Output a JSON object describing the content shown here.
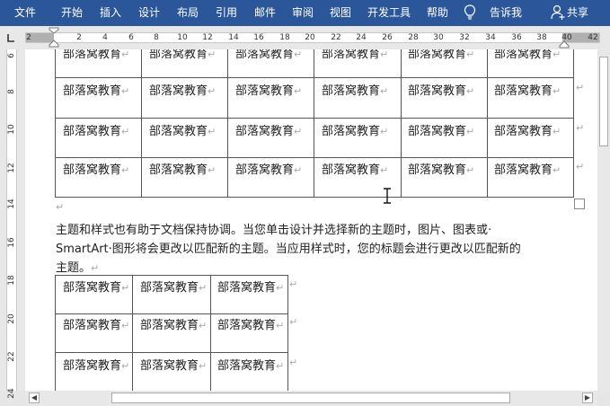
{
  "ribbon": {
    "tabs": [
      "文件",
      "开始",
      "插入",
      "设计",
      "布局",
      "引用",
      "邮件",
      "审阅",
      "视图",
      "开发工具",
      "帮助"
    ],
    "tell_me": "告诉我",
    "share": "共享",
    "background_color": "#2b579a"
  },
  "ruler": {
    "h_labels": [
      "2",
      "2",
      "4",
      "6",
      "8",
      "10",
      "12",
      "14",
      "16",
      "18",
      "20",
      "22",
      "24",
      "26",
      "28",
      "30",
      "32",
      "34",
      "36",
      "38",
      "40",
      "42"
    ],
    "v_labels": [
      "6",
      "8",
      "10",
      "12",
      "14",
      "16",
      "18",
      "20",
      "22",
      "24"
    ]
  },
  "document": {
    "cell_text": "部落窝教育",
    "table1_rows": [
      [
        "部落窝教育",
        "部落窝教育",
        "部落窝教育",
        "部落窝教育",
        "部落窝教育",
        "部落窝教育"
      ],
      [
        "部落窝教育",
        "部落窝教育",
        "部落窝教育",
        "部落窝教育",
        "部落窝教育",
        "部落窝教育"
      ],
      [
        "部落窝教育",
        "部落窝教育",
        "部落窝教育",
        "部落窝教育",
        "部落窝教育",
        "部落窝教育"
      ],
      [
        "部落窝教育",
        "部落窝教育",
        "部落窝教育",
        "部落窝教育",
        "部落窝教育",
        "部落窝教育"
      ]
    ],
    "paragraph_lines": [
      "主题和样式也有助于文档保持协调。当您单击设计并选择新的主题时，图片、图表或·",
      "SmartArt·图形将会更改以匹配新的主题。当应用样式时，您的标题会进行更改以匹配新的",
      "主题。"
    ],
    "table2_rows": [
      [
        "部落窝教育",
        "部落窝教育",
        "部落窝教育"
      ],
      [
        "部落窝教育",
        "部落窝教育",
        "部落窝教育"
      ],
      [
        "部落窝教育",
        "部落窝教育",
        "部落窝教育"
      ]
    ],
    "cell_mark": "↵",
    "para_mark": "↵"
  }
}
